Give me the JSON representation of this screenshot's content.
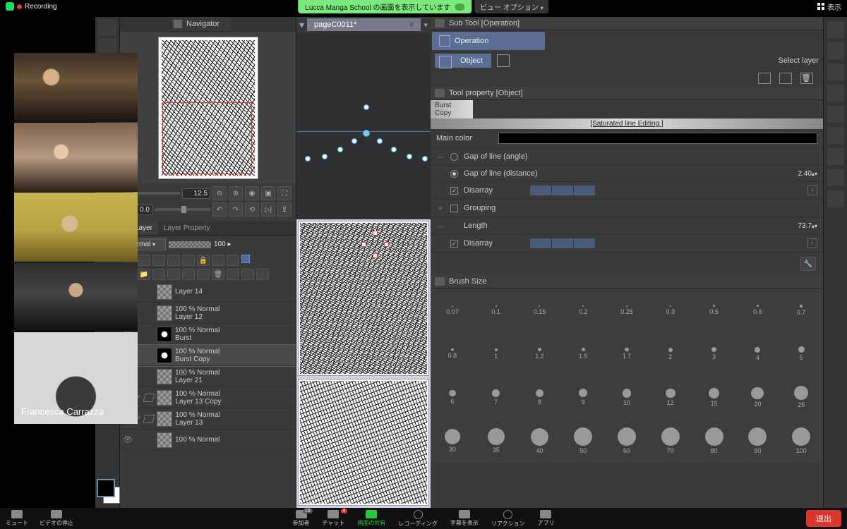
{
  "topbar": {
    "recording": "Recording",
    "share_text": "Lucca Manga School の画面を表示しています",
    "view_options": "ビュー オプション",
    "display": "表示"
  },
  "participants": {
    "tiles": [
      {
        "speaking": true
      },
      {
        "speaking": false
      },
      {
        "speaking": false
      },
      {
        "speaking": false
      },
      {
        "speaking": false,
        "name": "Francesca Carrazza"
      }
    ]
  },
  "navigator": {
    "title": "Navigator",
    "zoom_value": "12.5",
    "rotation_value": "0.0"
  },
  "document": {
    "tab": "pageC0011*",
    "close": "×"
  },
  "layer_panel": {
    "tab_layer": "Layer",
    "tab_layer_property": "Layer Property",
    "blend_mode": "Normal",
    "opacity": "100",
    "layers": [
      {
        "line1": "",
        "line2": "Layer 14",
        "sel": false,
        "burst": false
      },
      {
        "line1": "100 % Normal",
        "line2": "Layer 12",
        "sel": false,
        "burst": false
      },
      {
        "line1": "100 % Normal",
        "line2": "Burst",
        "sel": false,
        "burst": true
      },
      {
        "line1": "100 % Normal",
        "line2": "Burst Copy",
        "sel": true,
        "burst": true
      },
      {
        "line1": "100 % Normal",
        "line2": "Layer 21",
        "sel": false,
        "burst": false
      },
      {
        "line1": "100 % Normal",
        "line2": "Layer 13 Copy",
        "sel": false,
        "burst": false,
        "check": true
      },
      {
        "line1": "100 % Normal",
        "line2": "Layer 13",
        "sel": false,
        "burst": false,
        "check": true
      },
      {
        "line1": "100 % Normal",
        "line2": "",
        "sel": false,
        "burst": false
      }
    ]
  },
  "subtool": {
    "header": "Sub Tool [Operation]",
    "operation": "Operation",
    "object": "Object",
    "select_layer": "Select layer"
  },
  "tool_property": {
    "header": "Tool property [Object]",
    "burst_copy": "Burst Copy",
    "saturated": "[Saturated line Editing ]",
    "main_color": "Main color",
    "gap_angle": "Gap of line (angle)",
    "gap_distance": "Gap of line (distance)",
    "gap_distance_val": "2.40",
    "disarray": "Disarray",
    "grouping": "Grouping",
    "length": "Length",
    "length_val": "73.7"
  },
  "brush": {
    "header": "Brush Size",
    "sizes": [
      0.07,
      0.1,
      0.15,
      0.2,
      0.25,
      0.3,
      0.5,
      0.6,
      0.7,
      0.8,
      1,
      1.2,
      1.5,
      1.7,
      2,
      3,
      4,
      5,
      6,
      7,
      8,
      9,
      10,
      12,
      15,
      20,
      25,
      30,
      35,
      40,
      50,
      60,
      70,
      80,
      90,
      100
    ]
  },
  "bottombar": {
    "mute": "ミュート",
    "stop_video": "ビデオの停止",
    "participants": "参加者",
    "participants_count": "10",
    "chat": "チャット",
    "chat_badge": "4",
    "share": "画面の共有",
    "recording": "レコーディング",
    "captions": "字幕を表示",
    "reactions": "リアクション",
    "apps": "アプリ",
    "leave": "退出"
  }
}
